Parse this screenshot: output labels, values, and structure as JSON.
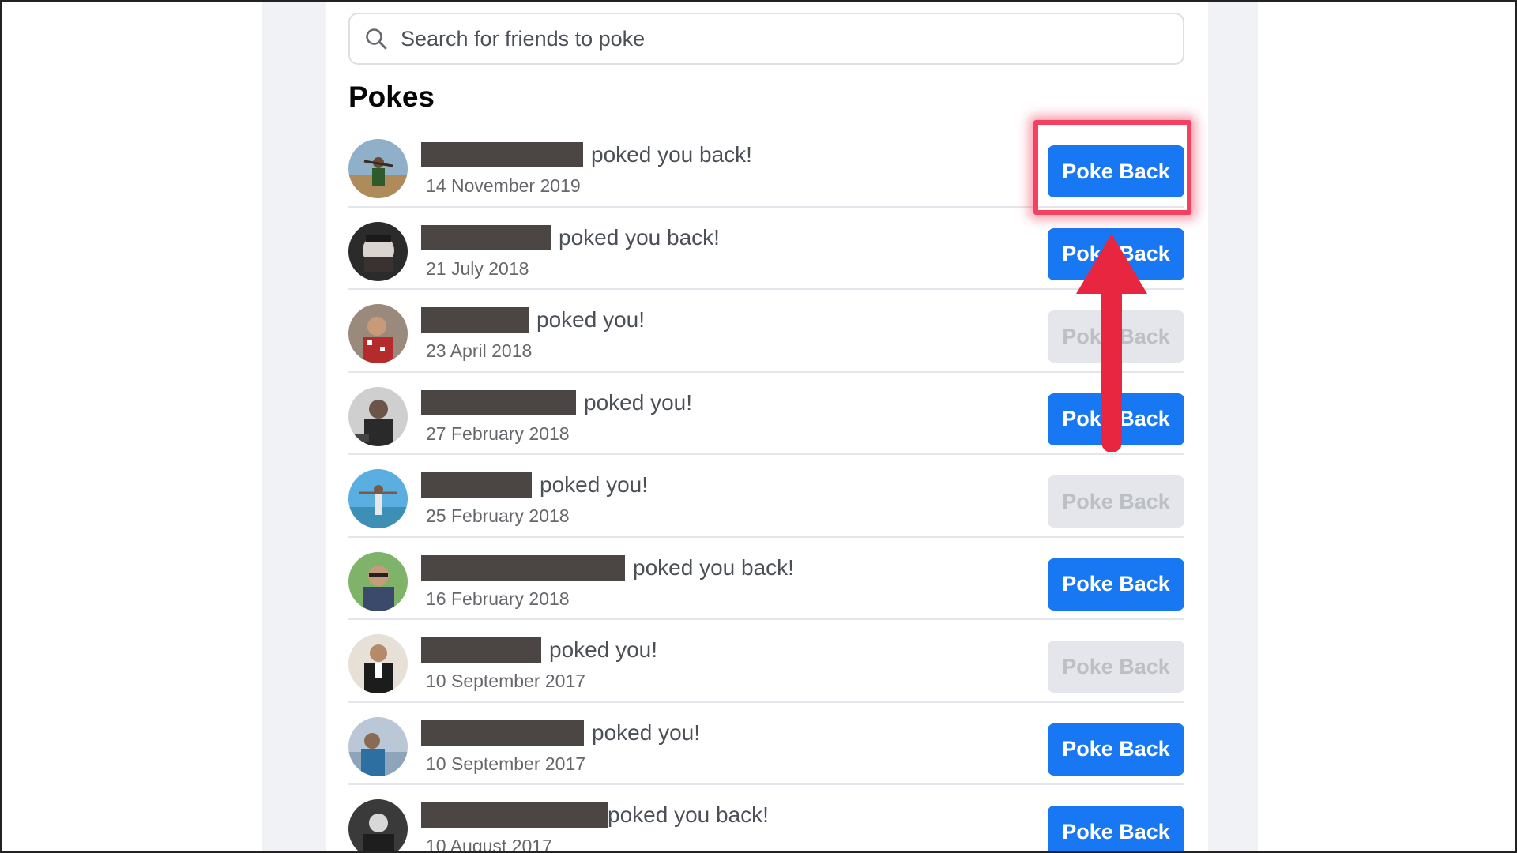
{
  "search": {
    "placeholder": "Search for friends to poke",
    "icon": "search-icon"
  },
  "section_title": "Pokes",
  "pokes": [
    {
      "message": "poked you back!",
      "date": "14 November 2019",
      "button": "Poke Back",
      "state": "active"
    },
    {
      "message": "poked you back!",
      "date": "21 July 2018",
      "button": "Poke Back",
      "state": "active"
    },
    {
      "message": "poked you!",
      "date": "23 April 2018",
      "button": "Poke Back",
      "state": "disabled"
    },
    {
      "message": "poked you!",
      "date": "27 February 2018",
      "button": "Poke Back",
      "state": "active"
    },
    {
      "message": "poked you!",
      "date": "25 February 2018",
      "button": "Poke Back",
      "state": "disabled"
    },
    {
      "message": "poked you back!",
      "date": "16 February 2018",
      "button": "Poke Back",
      "state": "active"
    },
    {
      "message": "poked you!",
      "date": "10 September 2017",
      "button": "Poke Back",
      "state": "disabled"
    },
    {
      "message": "poked you!",
      "date": "10 September 2017",
      "button": "Poke Back",
      "state": "active"
    },
    {
      "message": "poked you back!",
      "date": "10 August 2017",
      "button": "Poke Back",
      "state": "active"
    }
  ],
  "colors": {
    "accent": "#1877f2",
    "disabled_button": "#e4e6eb",
    "highlight": "#f5415f",
    "arrow": "#e8263f"
  }
}
